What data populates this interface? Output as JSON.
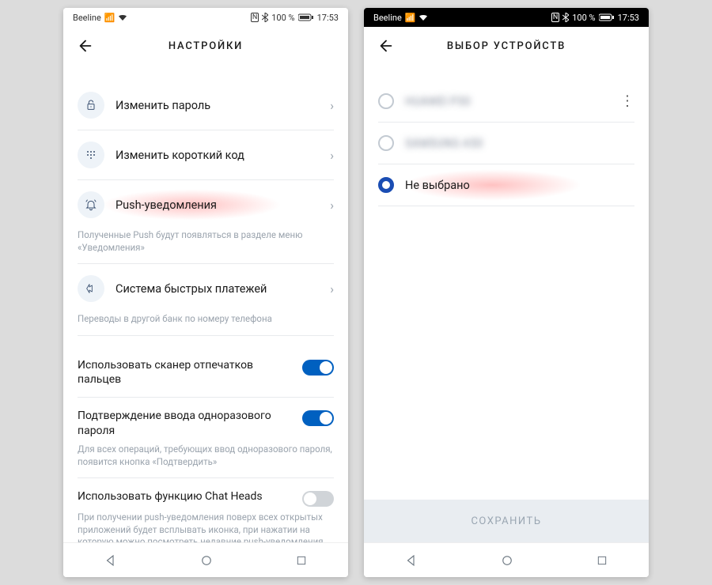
{
  "status": {
    "carrier": "Beeline",
    "battery": "100 %",
    "time": "17:53"
  },
  "left": {
    "title": "НАСТРОЙКИ",
    "items": {
      "password": "Изменить пароль",
      "code": "Изменить короткий код",
      "push": "Push-уведомления",
      "push_sub": "Полученные Push будут появляться в разделе меню «Уведомления»",
      "sbp": "Система быстрых платежей",
      "sbp_sub": "Переводы в другой банк по номеру телефона"
    },
    "toggles": {
      "fingerprint": {
        "label": "Использовать сканер отпечатков пальцев",
        "on": true
      },
      "otp": {
        "label": "Подтверждение ввода одноразового пароля",
        "on": true,
        "sub": "Для всех операций, требующих ввод одноразового пароля, появится кнопка «Подтвердить»"
      },
      "chatheads": {
        "label": "Использовать функцию Chat Heads",
        "on": false,
        "sub": "При получении push-уведомления поверх всех открытых приложений будет всплывать иконка, при нажатии на которую можно посмотреть недавние push-уведомления"
      }
    }
  },
  "right": {
    "title": "ВЫБОР УСТРОЙСТВ",
    "options": {
      "device1": "HUAWEI P30",
      "device2": "SAMSUNG A50",
      "none": "Не выбрано"
    },
    "save": "СОХРАНИТЬ"
  }
}
